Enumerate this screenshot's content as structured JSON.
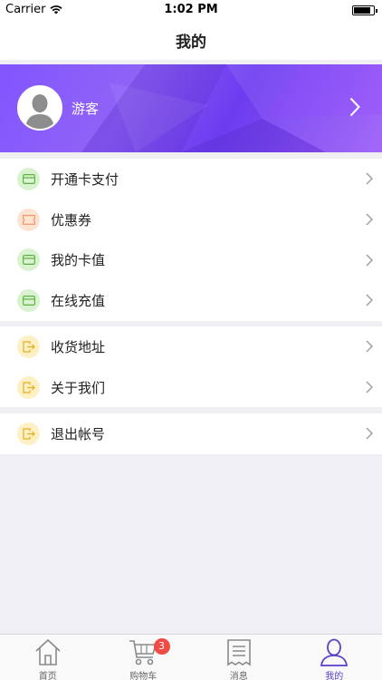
{
  "status_bar": {
    "carrier": "Carrier",
    "time": "1:02 PM"
  },
  "nav": {
    "title": "我的"
  },
  "profile": {
    "username": "游客"
  },
  "menu_groups": [
    {
      "items": [
        {
          "label": "开通卡支付",
          "icon": "card-icon"
        },
        {
          "label": "优惠券",
          "icon": "coupon-icon"
        },
        {
          "label": "我的卡值",
          "icon": "card-icon"
        },
        {
          "label": "在线充值",
          "icon": "card-icon"
        }
      ]
    },
    {
      "items": [
        {
          "label": "收货地址",
          "icon": "exit-icon"
        },
        {
          "label": "关于我们",
          "icon": "exit-icon"
        }
      ]
    },
    {
      "items": [
        {
          "label": "退出帐号",
          "icon": "exit-icon"
        }
      ]
    }
  ],
  "tabs": [
    {
      "label": "首页",
      "icon": "home-icon"
    },
    {
      "label": "购物车",
      "icon": "cart-icon",
      "badge": "3"
    },
    {
      "label": "消息",
      "icon": "receipt-icon"
    },
    {
      "label": "我的",
      "icon": "user-icon",
      "active": true
    }
  ],
  "colors": {
    "accent": "#5b3ec9",
    "banner": "#7c4dff",
    "badge": "#f04b45"
  }
}
